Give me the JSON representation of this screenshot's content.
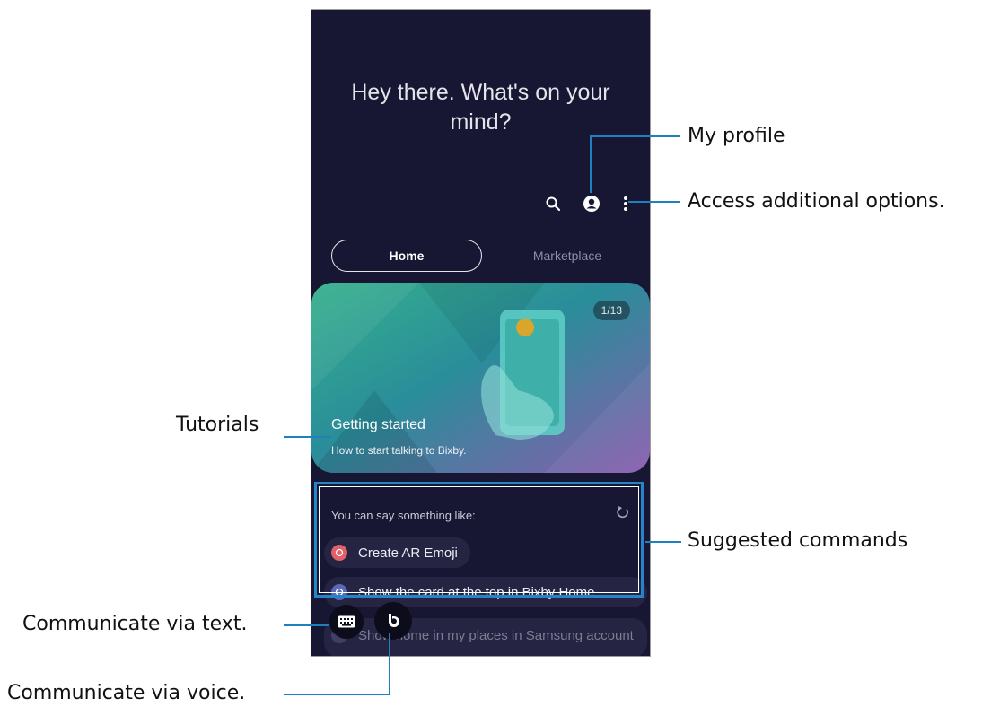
{
  "greeting": "Hey there. What's on your mind?",
  "toolbar": {
    "search_icon": "search-icon",
    "profile_icon": "profile-icon",
    "more_icon": "more-vertical-icon"
  },
  "tabs": {
    "home": "Home",
    "marketplace": "Marketplace"
  },
  "card": {
    "badge": "1/13",
    "title": "Getting started",
    "subtitle": "How to start talking to Bixby."
  },
  "suggestions": {
    "heading": "You can say something like:",
    "items": [
      "Create AR Emoji",
      "Show the card at the top in Bixby Home",
      "Show home in my places in Samsung account"
    ]
  },
  "callouts": {
    "my_profile": "My profile",
    "options": "Access additional options.",
    "tutorials": "Tutorials",
    "suggested": "Suggested commands",
    "text": "Communicate via text.",
    "voice": "Communicate via voice."
  },
  "colors": {
    "phone_bg": "#171633",
    "callout_line": "#1f7fbf",
    "card_teal": "#2aa79a",
    "card_purple": "#7c5aa8"
  }
}
